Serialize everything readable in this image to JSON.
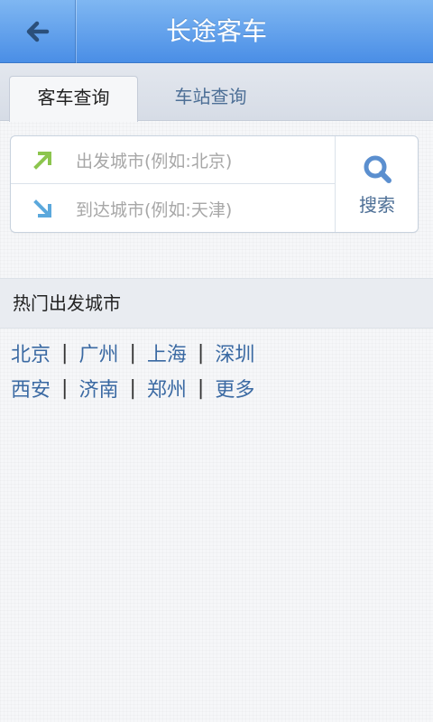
{
  "header": {
    "title": "长途客车"
  },
  "tabs": [
    {
      "label": "客车查询",
      "active": true
    },
    {
      "label": "车站查询",
      "active": false
    }
  ],
  "search": {
    "departure_placeholder": "出发城市(例如:北京)",
    "arrival_placeholder": "到达城市(例如:天津)",
    "button_label": "搜索"
  },
  "hot_cities": {
    "heading": "热门出发城市",
    "rows": [
      [
        "北京",
        "广州",
        "上海",
        "深圳"
      ],
      [
        "西安",
        "济南",
        "郑州",
        "更多"
      ]
    ],
    "separator": "|"
  },
  "colors": {
    "titlebar_top": "#7fb7f2",
    "titlebar_bottom": "#4a8ee6",
    "link": "#3b6aa3",
    "depart_arrow": "#8cc54e",
    "arrive_arrow": "#5ba8dc",
    "search_icon": "#5b8fcf"
  },
  "icons": {
    "back": "back-arrow-icon",
    "depart": "up-right-arrow-icon",
    "arrive": "down-right-arrow-icon",
    "search": "search-icon"
  }
}
